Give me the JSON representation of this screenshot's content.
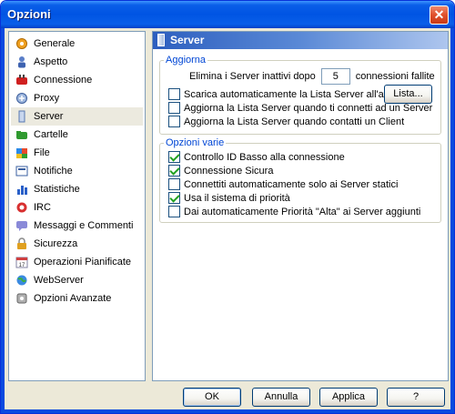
{
  "window": {
    "title": "Opzioni",
    "close": "✕"
  },
  "nav": {
    "items": [
      {
        "label": "Generale",
        "icon": "gear-icon"
      },
      {
        "label": "Aspetto",
        "icon": "person-icon"
      },
      {
        "label": "Connessione",
        "icon": "connection-icon"
      },
      {
        "label": "Proxy",
        "icon": "proxy-icon"
      },
      {
        "label": "Server",
        "icon": "server-icon"
      },
      {
        "label": "Cartelle",
        "icon": "folder-icon"
      },
      {
        "label": "File",
        "icon": "file-icon"
      },
      {
        "label": "Notifiche",
        "icon": "notification-icon"
      },
      {
        "label": "Statistiche",
        "icon": "statistics-icon"
      },
      {
        "label": "IRC",
        "icon": "irc-icon"
      },
      {
        "label": "Messaggi e Commenti",
        "icon": "messages-icon"
      },
      {
        "label": "Sicurezza",
        "icon": "security-icon"
      },
      {
        "label": "Operazioni Pianificate",
        "icon": "calendar-icon"
      },
      {
        "label": "WebServer",
        "icon": "globe-icon"
      },
      {
        "label": "Opzioni Avanzate",
        "icon": "advanced-icon"
      }
    ],
    "selected": "Server"
  },
  "panel": {
    "header": "Server",
    "aggiorna": {
      "legend": "Aggiorna",
      "remove_prefix": "Elimina i Server inattivi dopo",
      "remove_value": "5",
      "remove_suffix": "connessioni fallite",
      "download_label": "Scarica automaticamente la Lista Server all'avvio",
      "download_checked": false,
      "list_button": "Lista...",
      "update_connect_label": "Aggiorna la Lista Server quando ti connetti ad un Server",
      "update_connect_checked": false,
      "update_client_label": "Aggiorna la Lista Server quando contatti un Client",
      "update_client_checked": false
    },
    "varie": {
      "legend": "Opzioni varie",
      "items": [
        {
          "label": "Controllo ID Basso alla connessione",
          "checked": true
        },
        {
          "label": "Connessione Sicura",
          "checked": true
        },
        {
          "label": "Connettiti automaticamente solo ai Server statici",
          "checked": false
        },
        {
          "label": "Usa il sistema di priorità",
          "checked": true
        },
        {
          "label": "Dai automaticamente Priorità \"Alta\" ai Server aggiunti",
          "checked": false
        }
      ]
    }
  },
  "buttons": {
    "ok": "OK",
    "cancel": "Annulla",
    "apply": "Applica",
    "help": "?"
  }
}
